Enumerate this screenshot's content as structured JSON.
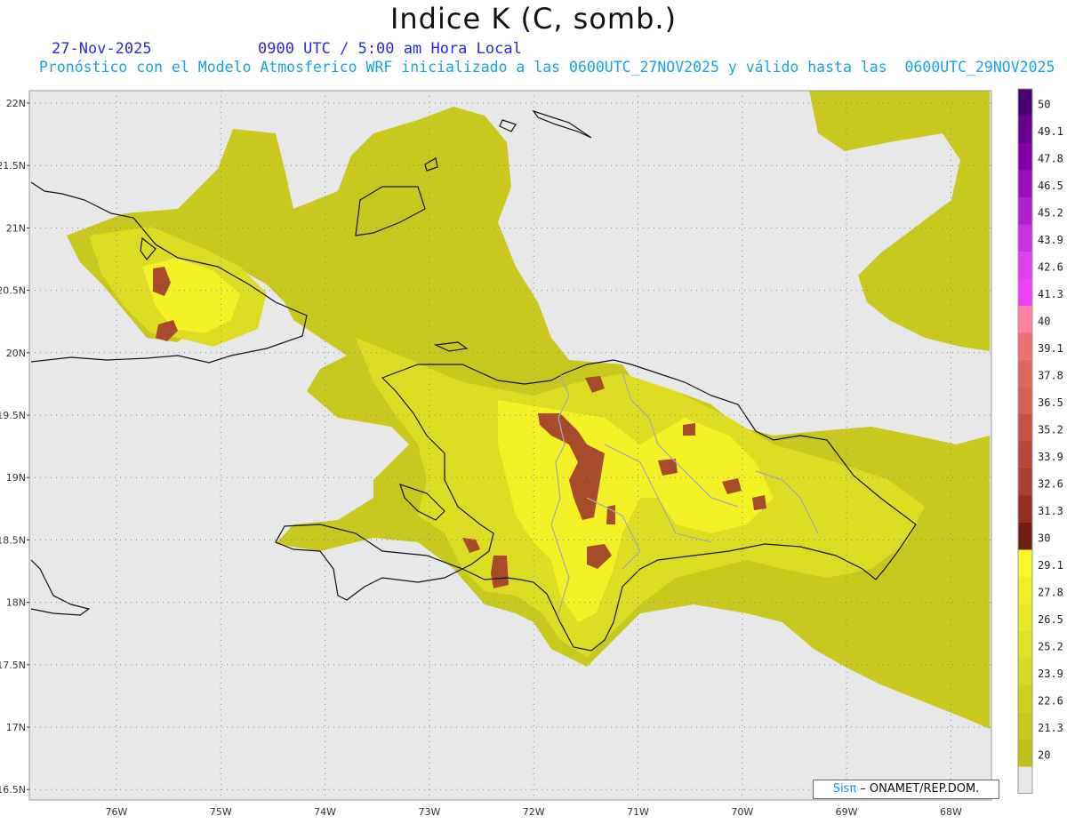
{
  "header": {
    "title": "Indice K (C, somb.)",
    "date": "27-Nov-2025",
    "time": "0900 UTC / 5:00 am Hora Local",
    "subtitle": "Pronóstico con el Modelo Atmosferico WRF inicializado a las 0600UTC_27NOV2025 y válido hasta las  0600UTC_29NOV2025"
  },
  "map": {
    "lat_labels": [
      "22N",
      "21.5N",
      "21N",
      "20.5N",
      "20N",
      "19.5N",
      "19N",
      "18.5N",
      "18N",
      "17.5N",
      "17N",
      "16.5N"
    ],
    "lon_labels": [
      "76W",
      "75W",
      "74W",
      "73W",
      "72W",
      "71W",
      "70W",
      "69W",
      "68W"
    ],
    "ocean_color": "#e8e8e8",
    "field_colors": {
      "low": "#cfcf20",
      "mid": "#d8d820",
      "high": "#f0f025",
      "max": "#a8402c"
    }
  },
  "colorbar": {
    "labels": [
      "50",
      "49.1",
      "47.8",
      "46.5",
      "45.2",
      "43.9",
      "42.6",
      "41.3",
      "40",
      "39.1",
      "37.8",
      "36.5",
      "35.2",
      "33.9",
      "32.6",
      "31.3",
      "30",
      "29.1",
      "27.8",
      "26.5",
      "25.2",
      "23.9",
      "22.6",
      "21.3",
      "20"
    ],
    "colors": [
      "#4a0070",
      "#6a0090",
      "#8000a8",
      "#9a10c0",
      "#b020d0",
      "#c830e0",
      "#e040f0",
      "#f040f8",
      "#ff80a0",
      "#f07070",
      "#e06a5a",
      "#d86050",
      "#c85040",
      "#b84838",
      "#a84030",
      "#903020",
      "#702010",
      "#f8f828",
      "#f0f025",
      "#e8e826",
      "#e0e024",
      "#d8d822",
      "#d0d020",
      "#c8c81e",
      "#c0c01c"
    ]
  },
  "credit": {
    "brand": "Sisπ",
    "text": " – ONAMET/REP.DOM."
  }
}
